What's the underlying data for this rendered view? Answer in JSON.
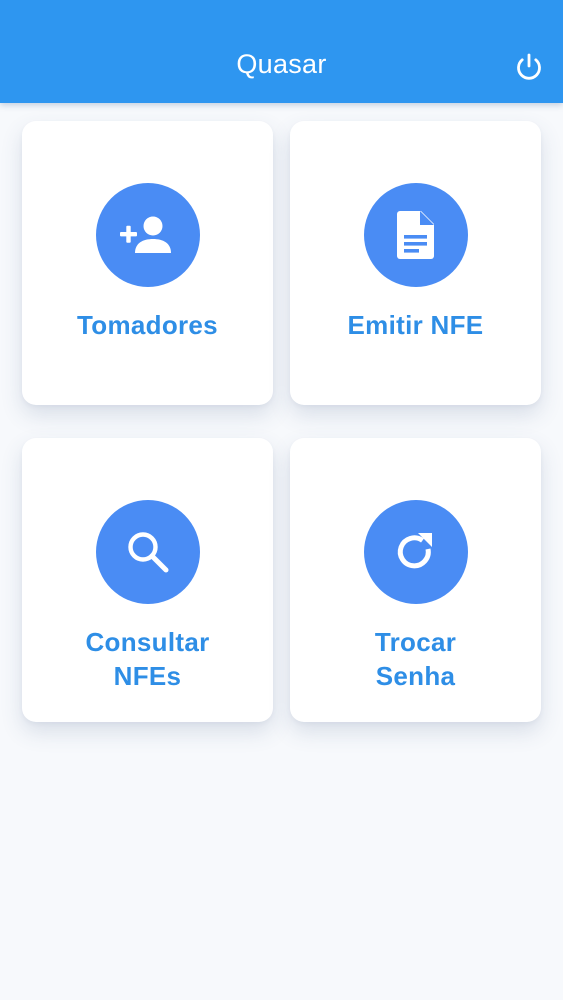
{
  "header": {
    "title": "Quasar",
    "logout_icon": "power-icon",
    "color": "#2e96f0"
  },
  "menu": {
    "accent_color": "#4a8cf4",
    "label_color": "#2e8ee6",
    "items": [
      {
        "icon": "person-add-icon",
        "label_lines": [
          "Tomadores"
        ]
      },
      {
        "icon": "document-icon",
        "label_lines": [
          "Emitir NFE"
        ]
      },
      {
        "icon": "search-icon",
        "label_lines": [
          "Consultar",
          "NFEs"
        ]
      },
      {
        "icon": "refresh-icon",
        "label_lines": [
          "Trocar",
          "Senha"
        ]
      }
    ]
  }
}
